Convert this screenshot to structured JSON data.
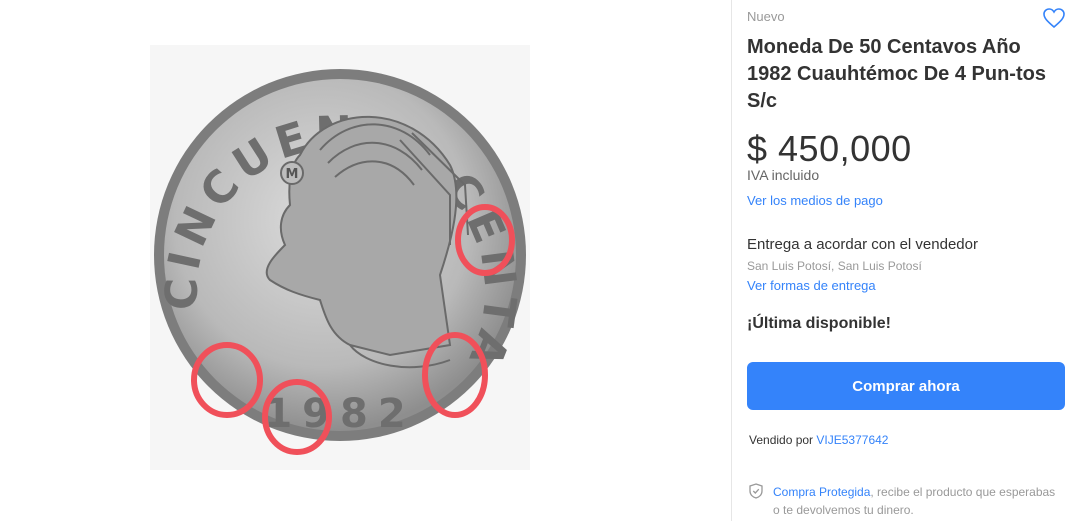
{
  "listing": {
    "condition": "Nuevo",
    "title": "Moneda De 50 Centavos Año 1982 Cuauhtémoc De 4 Pun-tos S/c",
    "price": "$ 450,000",
    "tax_note": "IVA incluido",
    "payment_link": "Ver los medios de pago"
  },
  "delivery": {
    "text": "Entrega a acordar con el vendedor",
    "location": "San Luis Potosí, San Luis Potosí",
    "options_link": "Ver formas de entrega"
  },
  "stock_text": "¡Última disponible!",
  "buy_button_label": "Comprar ahora",
  "seller": {
    "prefix": "Vendido por",
    "name": "VIJE5377642"
  },
  "protection": {
    "link": "Compra Protegida",
    "text": ", recibe el producto que esperabas o te devolvemos tu dinero."
  },
  "coin": {
    "text_top": "CINCUENTA CENTAVOS",
    "year": "1982",
    "monogram": "M"
  },
  "colors": {
    "accent": "#3483fa",
    "annotation": "#f0505a"
  },
  "icons": {
    "favorite": "heart-outline-icon",
    "protection": "shield-check-icon"
  }
}
